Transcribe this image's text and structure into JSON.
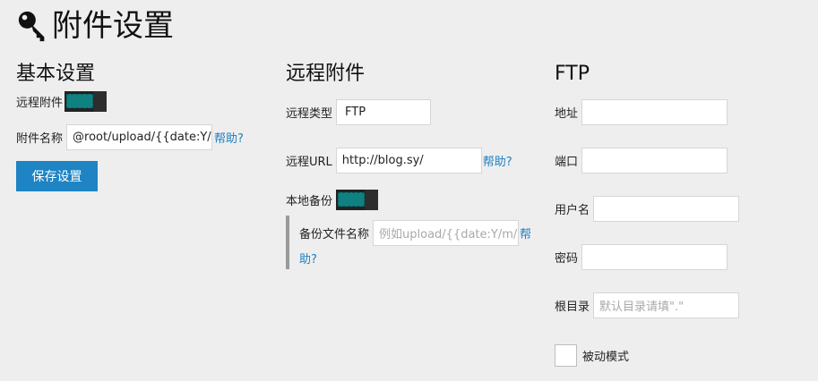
{
  "page": {
    "title": "附件设置"
  },
  "basic": {
    "heading": "基本设置",
    "remote_label": "远程附件",
    "name_label": "附件名称",
    "name_value": "@root/upload/{{date:Y/m/d}}",
    "help": "帮助?",
    "save": "保存设置"
  },
  "remote": {
    "heading": "远程附件",
    "type_label": "远程类型",
    "type_value": "FTP",
    "url_label": "远程URL",
    "url_value": "http://blog.sy/",
    "help": "帮助?",
    "backup_label": "本地备份",
    "backup_name_label": "备份文件名称",
    "backup_placeholder": "例如upload/{{date:Y/m/d}}",
    "backup_help_1": "帮",
    "backup_help_2": "助?"
  },
  "ftp": {
    "heading": "FTP",
    "host_label": "地址",
    "port_label": "端口",
    "user_label": "用户名",
    "password_label": "密码",
    "root_label": "根目录",
    "root_placeholder": "默认目录请填\".\"",
    "passive_label": "被动模式"
  },
  "colors": {
    "accent": "#1e84c4",
    "toggle_on": "#0f8181",
    "background": "#eeeeee"
  },
  "icons": {
    "title": "key-icon"
  }
}
